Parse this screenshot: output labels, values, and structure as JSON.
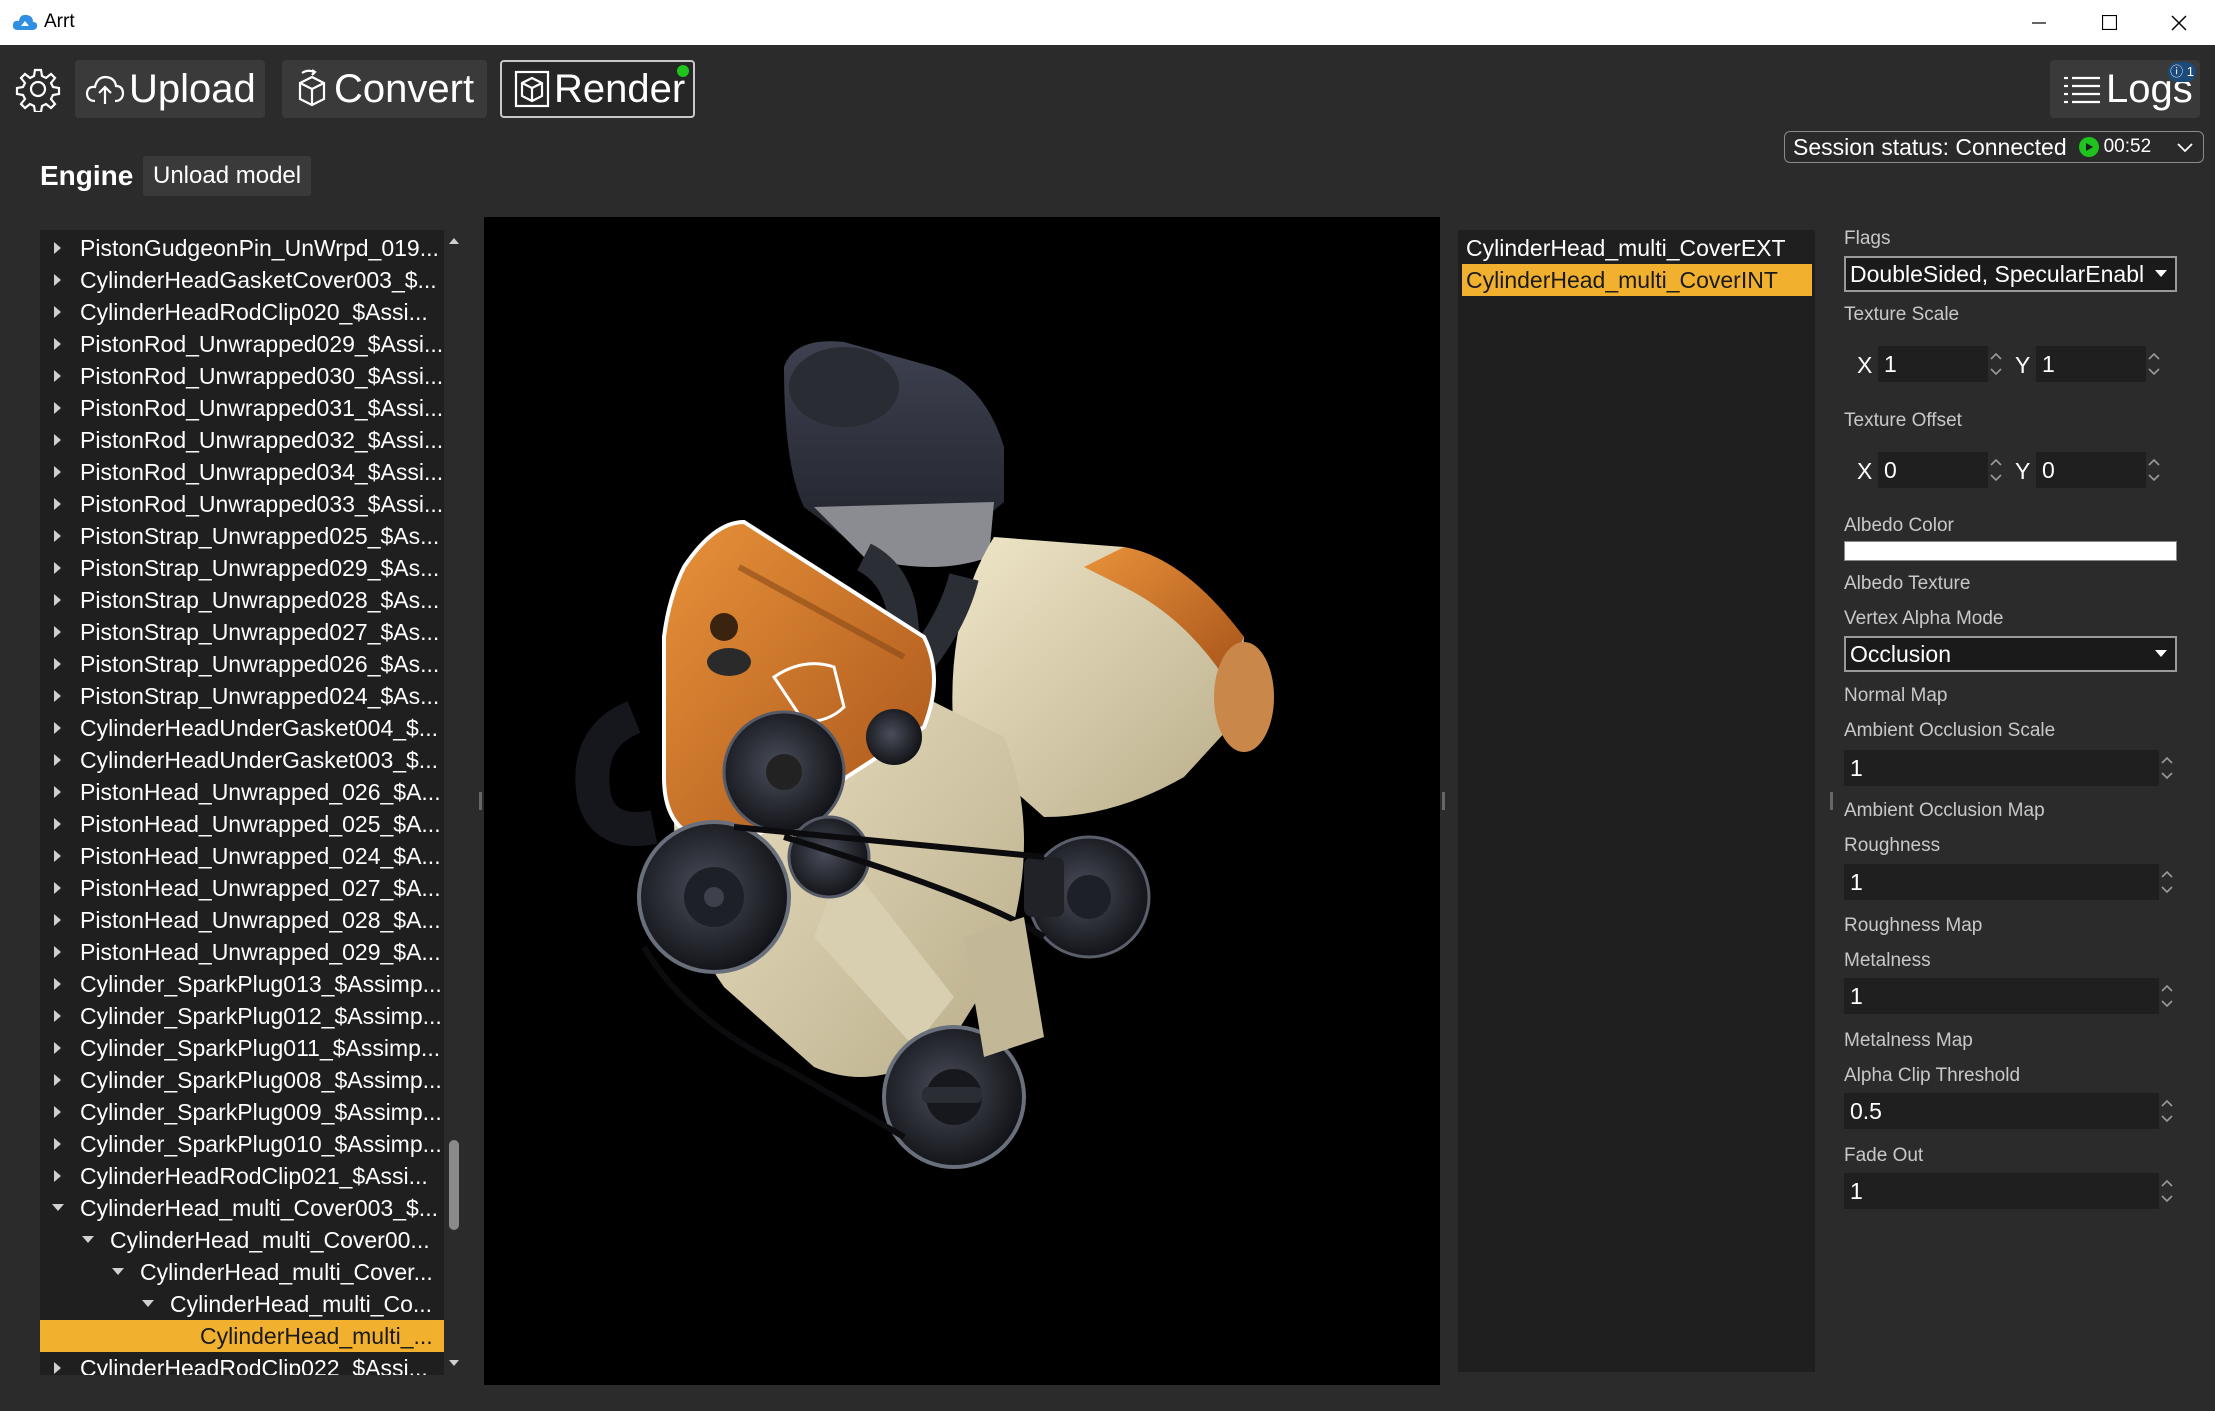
{
  "window": {
    "title": "Arrt"
  },
  "toolbar": {
    "upload": "Upload",
    "convert": "Convert",
    "render": "Render",
    "logs": "Logs",
    "logs_badge": "ⓘ 1"
  },
  "session": {
    "label": "Session status: Connected",
    "time": "00:52"
  },
  "model": {
    "name": "Engine",
    "unload_label": "Unload model"
  },
  "tree": {
    "items": [
      {
        "label": "PistonGudgeonPin_UnWrpd_019...",
        "level": 0,
        "expanded": false
      },
      {
        "label": "CylinderHeadGasketCover003_$...",
        "level": 0,
        "expanded": false
      },
      {
        "label": "CylinderHeadRodClip020_$Assi...",
        "level": 0,
        "expanded": false
      },
      {
        "label": "PistonRod_Unwrapped029_$Assi...",
        "level": 0,
        "expanded": false
      },
      {
        "label": "PistonRod_Unwrapped030_$Assi...",
        "level": 0,
        "expanded": false
      },
      {
        "label": "PistonRod_Unwrapped031_$Assi...",
        "level": 0,
        "expanded": false
      },
      {
        "label": "PistonRod_Unwrapped032_$Assi...",
        "level": 0,
        "expanded": false
      },
      {
        "label": "PistonRod_Unwrapped034_$Assi...",
        "level": 0,
        "expanded": false
      },
      {
        "label": "PistonRod_Unwrapped033_$Assi...",
        "level": 0,
        "expanded": false
      },
      {
        "label": "PistonStrap_Unwrapped025_$As...",
        "level": 0,
        "expanded": false
      },
      {
        "label": "PistonStrap_Unwrapped029_$As...",
        "level": 0,
        "expanded": false
      },
      {
        "label": "PistonStrap_Unwrapped028_$As...",
        "level": 0,
        "expanded": false
      },
      {
        "label": "PistonStrap_Unwrapped027_$As...",
        "level": 0,
        "expanded": false
      },
      {
        "label": "PistonStrap_Unwrapped026_$As...",
        "level": 0,
        "expanded": false
      },
      {
        "label": "PistonStrap_Unwrapped024_$As...",
        "level": 0,
        "expanded": false
      },
      {
        "label": "CylinderHeadUnderGasket004_$...",
        "level": 0,
        "expanded": false
      },
      {
        "label": "CylinderHeadUnderGasket003_$...",
        "level": 0,
        "expanded": false
      },
      {
        "label": "PistonHead_Unwrapped_026_$A...",
        "level": 0,
        "expanded": false
      },
      {
        "label": "PistonHead_Unwrapped_025_$A...",
        "level": 0,
        "expanded": false
      },
      {
        "label": "PistonHead_Unwrapped_024_$A...",
        "level": 0,
        "expanded": false
      },
      {
        "label": "PistonHead_Unwrapped_027_$A...",
        "level": 0,
        "expanded": false
      },
      {
        "label": "PistonHead_Unwrapped_028_$A...",
        "level": 0,
        "expanded": false
      },
      {
        "label": "PistonHead_Unwrapped_029_$A...",
        "level": 0,
        "expanded": false
      },
      {
        "label": "Cylinder_SparkPlug013_$Assimp...",
        "level": 0,
        "expanded": false
      },
      {
        "label": "Cylinder_SparkPlug012_$Assimp...",
        "level": 0,
        "expanded": false
      },
      {
        "label": "Cylinder_SparkPlug011_$Assimp...",
        "level": 0,
        "expanded": false
      },
      {
        "label": "Cylinder_SparkPlug008_$Assimp...",
        "level": 0,
        "expanded": false
      },
      {
        "label": "Cylinder_SparkPlug009_$Assimp...",
        "level": 0,
        "expanded": false
      },
      {
        "label": "Cylinder_SparkPlug010_$Assimp...",
        "level": 0,
        "expanded": false
      },
      {
        "label": "CylinderHeadRodClip021_$Assi...",
        "level": 0,
        "expanded": false
      },
      {
        "label": "CylinderHead_multi_Cover003_$...",
        "level": 0,
        "expanded": true
      },
      {
        "label": "CylinderHead_multi_Cover00...",
        "level": 1,
        "expanded": true
      },
      {
        "label": "CylinderHead_multi_Cover...",
        "level": 2,
        "expanded": true
      },
      {
        "label": "CylinderHead_multi_Co...",
        "level": 3,
        "expanded": true
      },
      {
        "label": "CylinderHead_multi_...",
        "level": 4,
        "expanded": null,
        "selected": true
      },
      {
        "label": "CylinderHeadRodClip022_$Assi...",
        "level": 0,
        "expanded": false
      }
    ]
  },
  "materials": {
    "items": [
      {
        "label": "CylinderHead_multi_CoverEXT",
        "selected": false
      },
      {
        "label": "CylinderHead_multi_CoverINT",
        "selected": true
      }
    ]
  },
  "properties": {
    "flags_label": "Flags",
    "flags_value": "DoubleSided, SpecularEnabl",
    "texture_scale_label": "Texture Scale",
    "texture_scale_x": "1",
    "texture_scale_y": "1",
    "texture_offset_label": "Texture Offset",
    "texture_offset_x": "0",
    "texture_offset_y": "0",
    "x_label": "X",
    "y_label": "Y",
    "albedo_color_label": "Albedo Color",
    "albedo_color_value": "#ffffff",
    "albedo_texture_label": "Albedo Texture",
    "vertex_alpha_mode_label": "Vertex Alpha Mode",
    "vertex_alpha_mode_value": "Occlusion",
    "normal_map_label": "Normal Map",
    "ao_scale_label": "Ambient Occlusion Scale",
    "ao_scale_value": "1",
    "ao_map_label": "Ambient Occlusion Map",
    "roughness_label": "Roughness",
    "roughness_value": "1",
    "roughness_map_label": "Roughness Map",
    "metalness_label": "Metalness",
    "metalness_value": "1",
    "metalness_map_label": "Metalness Map",
    "alpha_clip_label": "Alpha Clip Threshold",
    "alpha_clip_value": "0.5",
    "fade_out_label": "Fade Out",
    "fade_out_value": "1"
  },
  "colors": {
    "accent": "#f2b02f",
    "status_green": "#1ec31e",
    "background": "#2b2b2b",
    "panel": "#1f1f1f"
  }
}
